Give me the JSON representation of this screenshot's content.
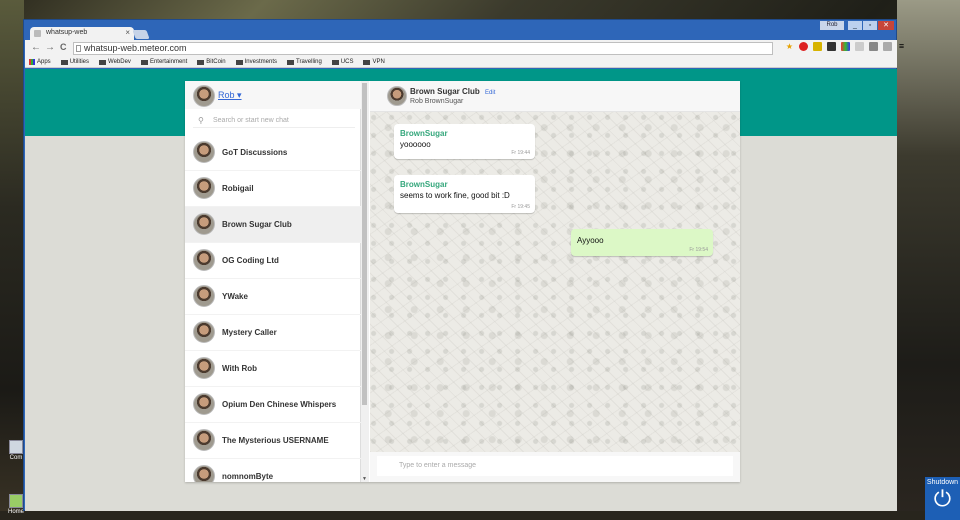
{
  "browser": {
    "tab_title": "whatsup-web",
    "tab_close": "×",
    "url": "whatsup-web.meteor.com",
    "user_badge": "Rob",
    "nav": {
      "back": "←",
      "forward": "→",
      "reload": "C"
    },
    "win": {
      "min": "_",
      "max": "▫",
      "close": "✕"
    },
    "menu": "≡",
    "bookmarks": [
      "Apps",
      "Utilities",
      "WebDev",
      "Entertainment",
      "BitCoin",
      "Investments",
      "Travelling",
      "UCS",
      "VPN"
    ]
  },
  "desktop": {
    "icons": [
      "Com",
      "Home"
    ],
    "shutdown_label": "Shutdown",
    "power_glyph": "⏻"
  },
  "app": {
    "me": {
      "name": "Rob ▾"
    },
    "search": {
      "placeholder": "Search or start new chat",
      "icon": "⚲"
    },
    "chats": [
      {
        "name": "GoT Discussions"
      },
      {
        "name": "Robigail"
      },
      {
        "name": "Brown Sugar Club",
        "active": true
      },
      {
        "name": "OG Coding Ltd"
      },
      {
        "name": "YWake"
      },
      {
        "name": "Mystery Caller"
      },
      {
        "name": "With Rob"
      },
      {
        "name": "Opium Den Chinese Whispers"
      },
      {
        "name": "The Mysterious USERNAME"
      },
      {
        "name": "nomnomByte"
      }
    ],
    "header": {
      "title": "Brown Sugar Club",
      "edit": "Edit",
      "members": "Rob BrownSugar"
    },
    "messages": [
      {
        "sender": "BrownSugar",
        "text": "yoooooo",
        "time": "Fr 19:44",
        "outgoing": false
      },
      {
        "sender": "BrownSugar",
        "text": "seems to work fine, good bit :D",
        "time": "Fr 19:45",
        "outgoing": false
      },
      {
        "sender": "",
        "text": "Ayyooo",
        "time": "Fr 19:54",
        "outgoing": true
      }
    ],
    "composer": {
      "placeholder": "Type to enter a message"
    }
  },
  "colors": {
    "teal_header": "#009688",
    "sender_green": "#35a77c",
    "outgoing_bubble": "#dcf8c6",
    "link_blue": "#3367d6"
  }
}
